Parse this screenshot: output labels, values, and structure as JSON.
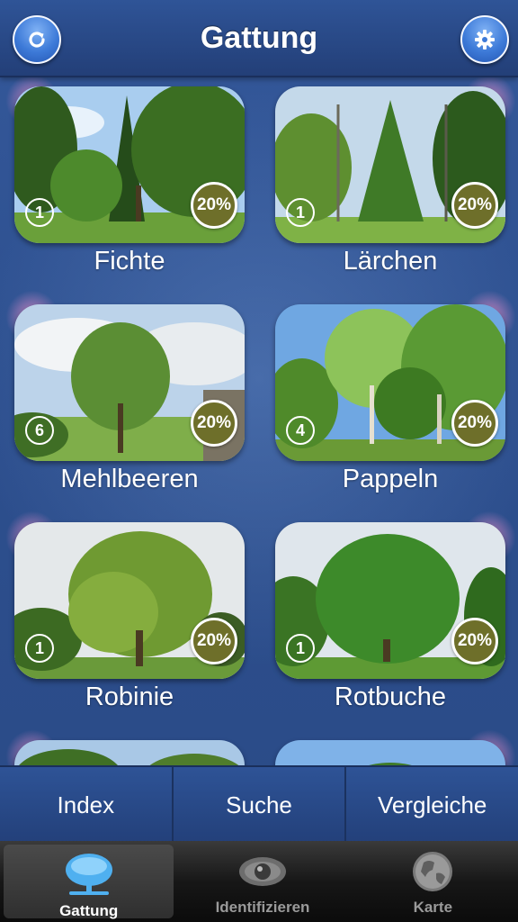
{
  "header": {
    "title": "Gattung",
    "left_icon": "refresh-icon",
    "right_icon": "gear-icon"
  },
  "tiles": [
    {
      "label": "Fichte",
      "count": "1",
      "percent": "20%",
      "scene": "forest"
    },
    {
      "label": "Lärchen",
      "count": "1",
      "percent": "20%",
      "scene": "larch"
    },
    {
      "label": "Mehlbeeren",
      "count": "6",
      "percent": "20%",
      "scene": "meadow"
    },
    {
      "label": "Pappeln",
      "count": "4",
      "percent": "20%",
      "scene": "poplar"
    },
    {
      "label": "Robinie",
      "count": "1",
      "percent": "20%",
      "scene": "robinia"
    },
    {
      "label": "Rotbuche",
      "count": "1",
      "percent": "20%",
      "scene": "beech"
    }
  ],
  "segments": [
    {
      "label": "Index"
    },
    {
      "label": "Suche"
    },
    {
      "label": "Vergleiche"
    }
  ],
  "tabs": [
    {
      "label": "Gattung",
      "icon": "tree-icon",
      "active": true
    },
    {
      "label": "Identifizieren",
      "icon": "eye-icon",
      "active": false
    },
    {
      "label": "Karte",
      "icon": "globe-icon",
      "active": false
    }
  ],
  "colors": {
    "header": "#2f5497",
    "background": "#2c4f8f",
    "percent_badge": "#6e6f2a",
    "tabbar": "#171717"
  }
}
